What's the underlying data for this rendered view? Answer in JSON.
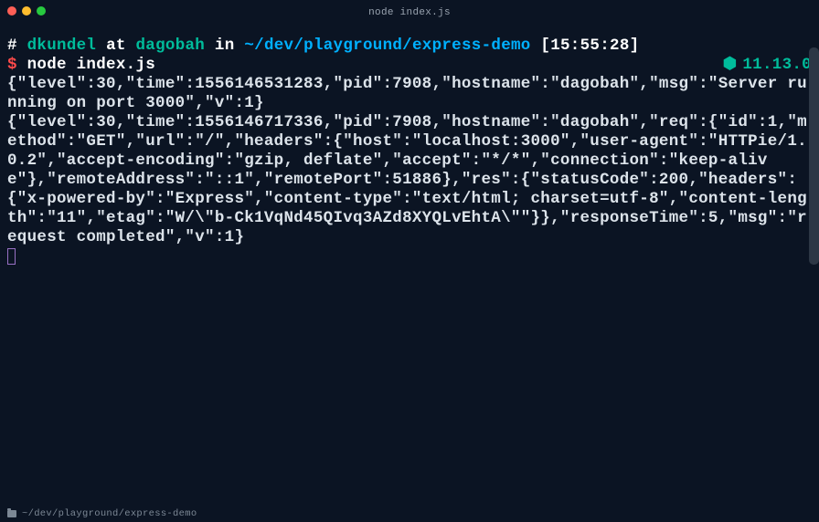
{
  "window": {
    "title": "node index.js"
  },
  "prompt": {
    "pound": "#",
    "user": "dkundel",
    "at": "at",
    "host": "dagobah",
    "in": "in",
    "cwd": "~/dev/playground/express-demo",
    "time": "[15:55:28]"
  },
  "command": {
    "dollar": "$",
    "text": "node index.js"
  },
  "nodeVersion": {
    "hex": "⬢",
    "value": "11.13.0"
  },
  "logs": {
    "line1": "{\"level\":30,\"time\":1556146531283,\"pid\":7908,\"hostname\":\"dagobah\",\"msg\":\"Server running on port 3000\",\"v\":1}",
    "line2": "{\"level\":30,\"time\":1556146717336,\"pid\":7908,\"hostname\":\"dagobah\",\"req\":{\"id\":1,\"method\":\"GET\",\"url\":\"/\",\"headers\":{\"host\":\"localhost:3000\",\"user-agent\":\"HTTPie/1.0.2\",\"accept-encoding\":\"gzip, deflate\",\"accept\":\"*/*\",\"connection\":\"keep-alive\"},\"remoteAddress\":\"::1\",\"remotePort\":51886},\"res\":{\"statusCode\":200,\"headers\":{\"x-powered-by\":\"Express\",\"content-type\":\"text/html; charset=utf-8\",\"content-length\":\"11\",\"etag\":\"W/\\\"b-Ck1VqNd45QIvq3AZd8XYQLvEhtA\\\"\"}},\"responseTime\":5,\"msg\":\"request completed\",\"v\":1}"
  },
  "statusbar": {
    "path": "~/dev/playground/express-demo"
  }
}
